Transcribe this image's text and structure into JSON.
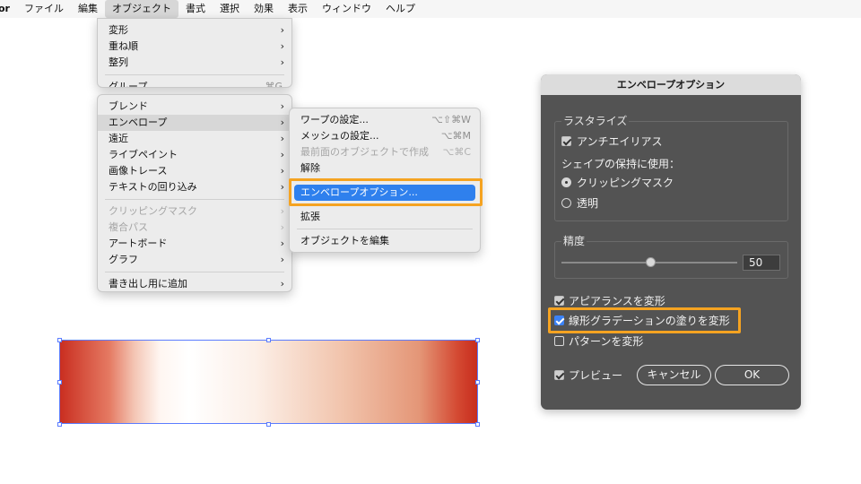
{
  "menubar": {
    "app_name": "or",
    "items": [
      "ファイル",
      "編集",
      "オブジェクト",
      "書式",
      "選択",
      "効果",
      "表示",
      "ウィンドウ",
      "ヘルプ"
    ]
  },
  "object_menu": {
    "top_items": [
      {
        "label": "変形",
        "submenu": true
      },
      {
        "label": "重ね順",
        "submenu": true
      },
      {
        "label": "整列",
        "submenu": true
      },
      {
        "label": "グループ",
        "shortcut": "⌘G"
      }
    ],
    "items": [
      {
        "label": "ブレンド",
        "submenu": true
      },
      {
        "label": "エンベロープ",
        "submenu": true
      },
      {
        "label": "遠近",
        "submenu": true
      },
      {
        "label": "ライブペイント",
        "submenu": true
      },
      {
        "label": "画像トレース",
        "submenu": true
      },
      {
        "label": "テキストの回り込み",
        "submenu": true
      },
      {
        "label": "クリッピングマスク",
        "submenu": true,
        "disabled": true
      },
      {
        "label": "複合パス",
        "submenu": true,
        "disabled": true
      },
      {
        "label": "アートボード",
        "submenu": true
      },
      {
        "label": "グラフ",
        "submenu": true
      },
      {
        "label": "書き出し用に追加",
        "submenu": true
      }
    ],
    "arrow": "›"
  },
  "envelope_menu": {
    "items": [
      {
        "label": "ワープの設定...",
        "shortcut": "⌥⇧⌘W"
      },
      {
        "label": "メッシュの設定...",
        "shortcut": "⌥⌘M"
      },
      {
        "label": "最前面のオブジェクトで作成",
        "shortcut": "⌥⌘C",
        "disabled": true
      },
      {
        "label": "解除"
      },
      {
        "label": "エンベロープオプション..."
      },
      {
        "label": "拡張"
      },
      {
        "label": "オブジェクトを編集"
      }
    ]
  },
  "dialog": {
    "title": "エンベロープオプション",
    "rasterize_label": "ラスタライズ",
    "antialias_label": "アンチエイリアス",
    "shape_preserve_label": "シェイプの保持に使用：",
    "clipping_mask_label": "クリッピングマスク",
    "transparency_label": "透明",
    "precision_label": "精度",
    "precision_value": "50",
    "precision_fraction": 0.5,
    "distort_appearance_label": "アピアランスを変形",
    "distort_gradient_label": "線形グラデーションの塗りを変形",
    "distort_pattern_label": "パターンを変形",
    "preview_label": "プレビュー",
    "cancel_label": "キャンセル",
    "ok_label": "OK"
  },
  "colors": {
    "highlight": "#f5a321",
    "selection_blue": "#2f80ed",
    "gradient_red": "#c92d1f",
    "dialog_bg": "#535353"
  }
}
